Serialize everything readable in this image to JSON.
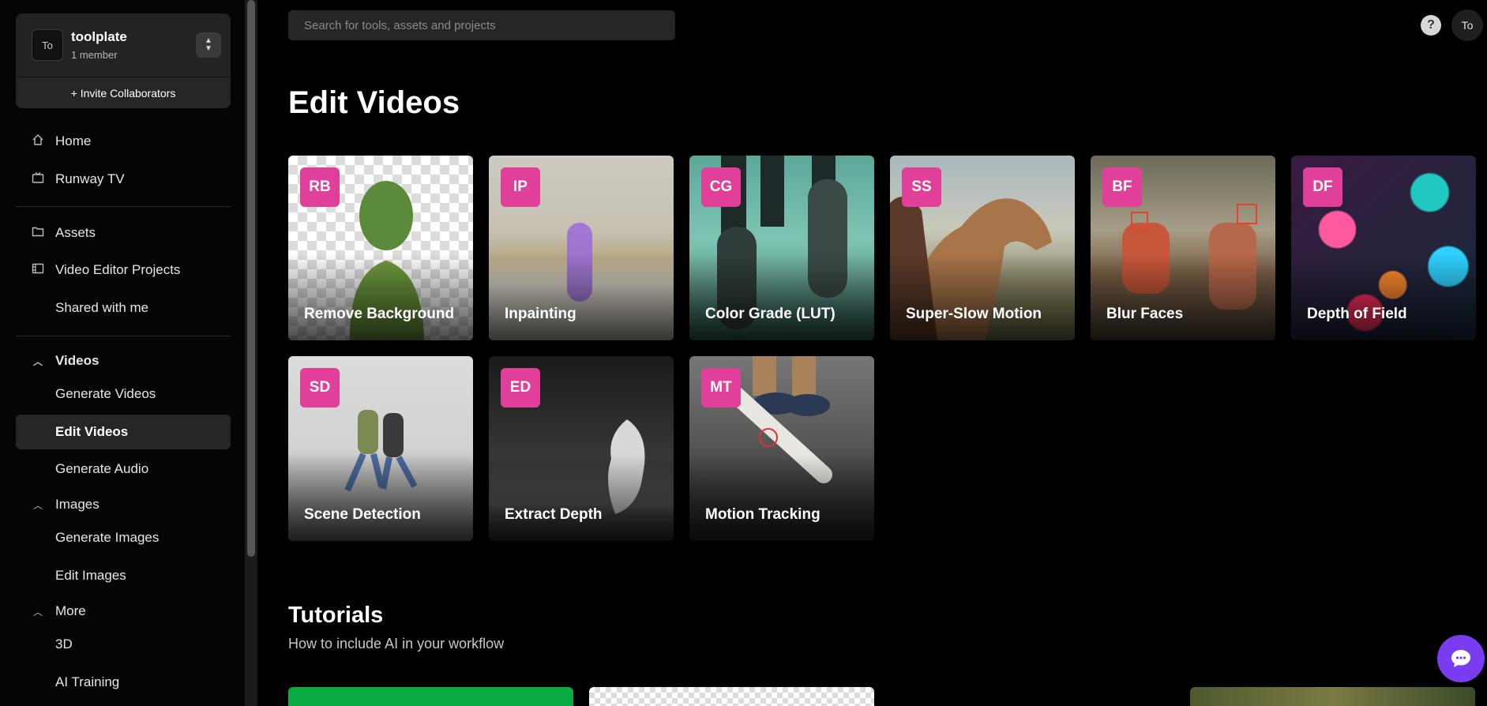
{
  "team": {
    "avatar": "To",
    "name": "toolplate",
    "members": "1 member",
    "invite_label": "+ Invite Collaborators"
  },
  "nav": {
    "home": "Home",
    "runway_tv": "Runway TV",
    "assets": "Assets",
    "video_editor_projects": "Video Editor Projects",
    "shared_with_me": "Shared with me",
    "videos": "Videos",
    "generate_videos": "Generate Videos",
    "edit_videos": "Edit Videos",
    "generate_audio": "Generate Audio",
    "images": "Images",
    "generate_images": "Generate Images",
    "edit_images": "Edit Images",
    "more": "More",
    "three_d": "3D",
    "ai_training": "AI Training"
  },
  "header": {
    "search_placeholder": "Search for tools, assets and projects",
    "help": "?",
    "user": "To"
  },
  "page_title": "Edit Videos",
  "tools": [
    {
      "badge": "RB",
      "label": "Remove Background"
    },
    {
      "badge": "IP",
      "label": "Inpainting"
    },
    {
      "badge": "CG",
      "label": "Color Grade (LUT)"
    },
    {
      "badge": "SS",
      "label": "Super-Slow Motion"
    },
    {
      "badge": "BF",
      "label": "Blur Faces"
    },
    {
      "badge": "DF",
      "label": "Depth of Field"
    },
    {
      "badge": "SD",
      "label": "Scene Detection"
    },
    {
      "badge": "ED",
      "label": "Extract Depth"
    },
    {
      "badge": "MT",
      "label": "Motion Tracking"
    }
  ],
  "tutorials": {
    "title": "Tutorials",
    "subtitle": "How to include AI in your workflow"
  },
  "icons": {
    "home": "home-icon",
    "tv": "tv-icon",
    "folder": "folder-icon",
    "video_project": "film-icon",
    "chevron": "chevron-up-icon",
    "chat": "chat-icon"
  },
  "colors": {
    "badge": "#e0409a",
    "chat": "#7a3cf0",
    "active_item": "#262626"
  }
}
